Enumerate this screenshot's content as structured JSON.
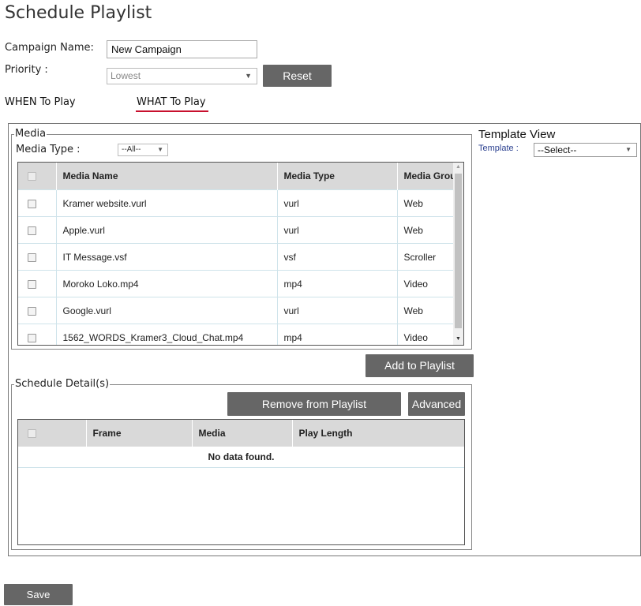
{
  "page": {
    "title": "Schedule Playlist"
  },
  "form": {
    "campaign_label": "Campaign Name:",
    "campaign_value": "New Campaign",
    "priority_label": "Priority :",
    "priority_value": "Lowest",
    "reset_label": "Reset"
  },
  "tabs": [
    {
      "label": "WHEN To Play",
      "active": false
    },
    {
      "label": "WHAT To Play",
      "active": true
    }
  ],
  "media": {
    "legend": "Media",
    "type_label": "Media Type :",
    "type_value": "--All--",
    "columns": [
      "Media Name",
      "Media Type",
      "Media Grou"
    ],
    "rows": [
      {
        "name": "Kramer website.vurl",
        "type": "vurl",
        "group": "Web"
      },
      {
        "name": "Apple.vurl",
        "type": "vurl",
        "group": "Web"
      },
      {
        "name": "IT Message.vsf",
        "type": "vsf",
        "group": "Scroller"
      },
      {
        "name": "Moroko Loko.mp4",
        "type": "mp4",
        "group": "Video"
      },
      {
        "name": "Google.vurl",
        "type": "vurl",
        "group": "Web"
      },
      {
        "name": "1562_WORDS_Kramer3_Cloud_Chat.mp4",
        "type": "mp4",
        "group": "Video"
      }
    ],
    "add_label": "Add to Playlist"
  },
  "template": {
    "title": "Template View",
    "label": "Template :",
    "value": "--Select--"
  },
  "schedule": {
    "legend": "Schedule Detail(s)",
    "remove_label": "Remove from Playlist",
    "advanced_label": "Advanced",
    "columns": [
      "Frame",
      "Media",
      "Play Length"
    ],
    "empty": "No data found."
  },
  "footer": {
    "save_label": "Save"
  },
  "colors": {
    "accent": "#c8102e",
    "button": "#666666",
    "header_bg": "#d9d9d9"
  }
}
